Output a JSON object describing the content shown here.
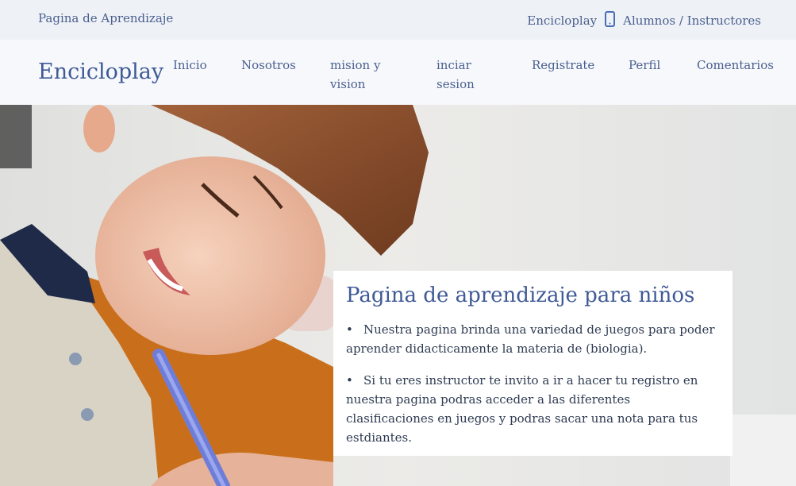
{
  "topbar": {
    "site_label": "Pagina de Aprendizaje",
    "brand_small": "Encicloplay",
    "audience": "Alumnos / Instructores"
  },
  "navbar": {
    "brand": "Encicloplay",
    "items": [
      {
        "label_line1": "Inicio",
        "label_line2": ""
      },
      {
        "label_line1": "Nosotros",
        "label_line2": ""
      },
      {
        "label_line1": "mision y",
        "label_line2": "vision"
      },
      {
        "label_line1": "inciar",
        "label_line2": "sesion"
      },
      {
        "label_line1": "Registrate",
        "label_line2": ""
      },
      {
        "label_line1": "Perfil",
        "label_line2": ""
      },
      {
        "label_line1": "Comentarios",
        "label_line2": ""
      }
    ]
  },
  "hero": {
    "image_description": "child writing with a pencil",
    "card_title": "Pagina de aprendizaje para niños",
    "bullets": [
      "Nuestra pagina brinda una variedad de juegos para poder aprender didacticamente la materia de (biologia).",
      "Si tu eres instructor te invito a ir a hacer tu registro en nuestra pagina podras acceder a las diferentes clasificaciones en juegos y podras sacar una nota para tus estdiantes."
    ]
  },
  "colors": {
    "brand_blue": "#3f5a96",
    "topbar_bg": "#eef1f6",
    "navbar_bg": "#f6f8fb"
  }
}
